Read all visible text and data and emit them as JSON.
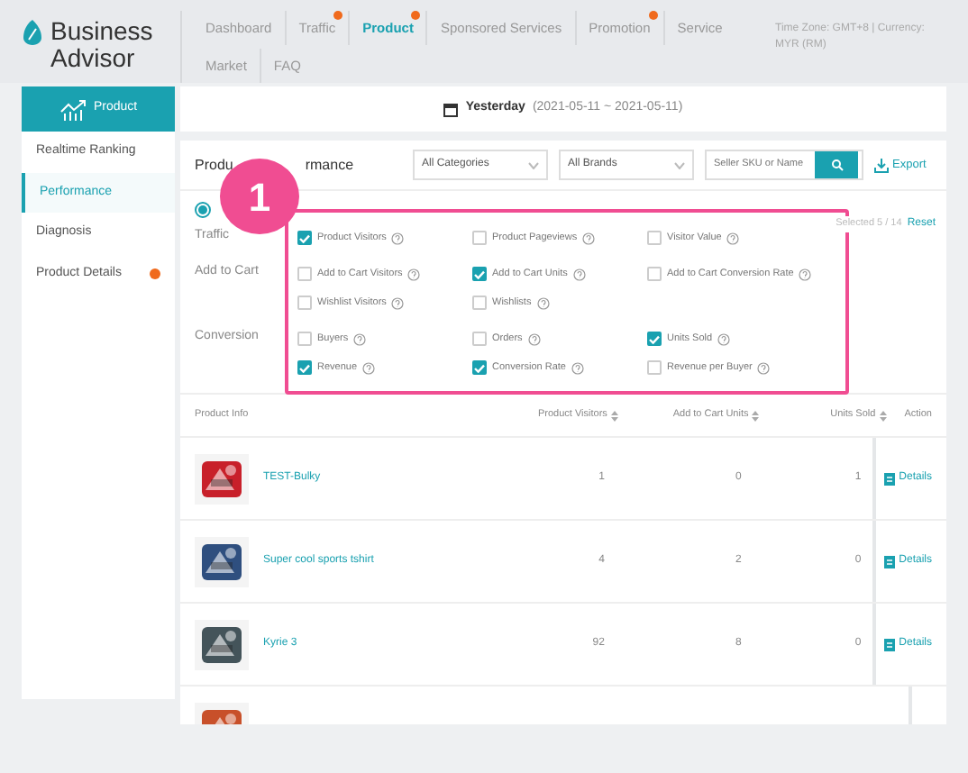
{
  "brand": {
    "line1": "Business",
    "line2": "Advisor"
  },
  "nav": [
    {
      "label": "Dashboard",
      "selected": false,
      "dot": false
    },
    {
      "label": "Traffic",
      "selected": false,
      "dot": true
    },
    {
      "label": "Product",
      "selected": true,
      "dot": true
    },
    {
      "label": "Sponsored Services",
      "selected": false,
      "dot": false
    },
    {
      "label": "Promotion",
      "selected": false,
      "dot": true
    },
    {
      "label": "Service",
      "selected": false,
      "dot": false
    },
    {
      "label": "Market",
      "selected": false,
      "dot": false
    },
    {
      "label": "FAQ",
      "selected": false,
      "dot": false
    }
  ],
  "header_info": "Time Zone: GMT+8 | Currency: MYR (RM)",
  "sidebar": {
    "title": "Product",
    "items": [
      {
        "label": "Realtime Ranking",
        "selected": false,
        "dot": false
      },
      {
        "label": "Performance",
        "selected": true,
        "dot": false
      },
      {
        "label": "Diagnosis",
        "selected": false,
        "dot": false
      },
      {
        "label": "Product Details",
        "selected": false,
        "dot": true
      }
    ]
  },
  "date": {
    "label": "Yesterday",
    "range": "(2021-05-11 ~ 2021-05-11)"
  },
  "toolbar": {
    "title_start": "Produ",
    "title_end": "rmance",
    "categories": "All Categories",
    "brands": "All Brands",
    "search_placeholder": "Seller SKU or Name",
    "export": "Export"
  },
  "radio": {
    "selected": true
  },
  "step_badge": "1",
  "selected_count": "Selected 5 / 14",
  "reset": "Reset",
  "metric_groups": [
    {
      "label": "Traffic",
      "rows": [
        [
          {
            "label": "Product Visitors",
            "checked": true
          },
          {
            "label": "Product Pageviews",
            "checked": false
          },
          {
            "label": "Visitor Value",
            "checked": false
          }
        ]
      ]
    },
    {
      "label": "Add to Cart",
      "rows": [
        [
          {
            "label": "Add to Cart Visitors",
            "checked": false
          },
          {
            "label": "Add to Cart Units",
            "checked": true
          },
          {
            "label": "Add to Cart Conversion Rate",
            "checked": false
          }
        ],
        [
          {
            "label": "Wishlist Visitors",
            "checked": false
          },
          {
            "label": "Wishlists",
            "checked": false
          }
        ]
      ]
    },
    {
      "label": "Conversion",
      "rows": [
        [
          {
            "label": "Buyers",
            "checked": false
          },
          {
            "label": "Orders",
            "checked": false
          },
          {
            "label": "Units Sold",
            "checked": true
          }
        ],
        [
          {
            "label": "Revenue",
            "checked": true
          },
          {
            "label": "Conversion Rate",
            "checked": true
          },
          {
            "label": "Revenue per Buyer",
            "checked": false
          }
        ]
      ]
    }
  ],
  "table": {
    "columns": [
      {
        "label": "Product Info",
        "sortable": false
      },
      {
        "label": "Product Visitors",
        "sortable": true
      },
      {
        "label": "Add to Cart Units",
        "sortable": true
      },
      {
        "label": "Units Sold",
        "sortable": true
      },
      {
        "label": "Action",
        "sortable": false
      }
    ],
    "rows": [
      {
        "name": "TEST-Bulky",
        "visitors": "1",
        "cart": "0",
        "sold": "1",
        "action": "Details"
      },
      {
        "name": "Super cool sports tshirt",
        "visitors": "4",
        "cart": "2",
        "sold": "0",
        "action": "Details"
      },
      {
        "name": "Kyrie 3",
        "visitors": "92",
        "cart": "8",
        "sold": "0",
        "action": "Details"
      }
    ]
  }
}
